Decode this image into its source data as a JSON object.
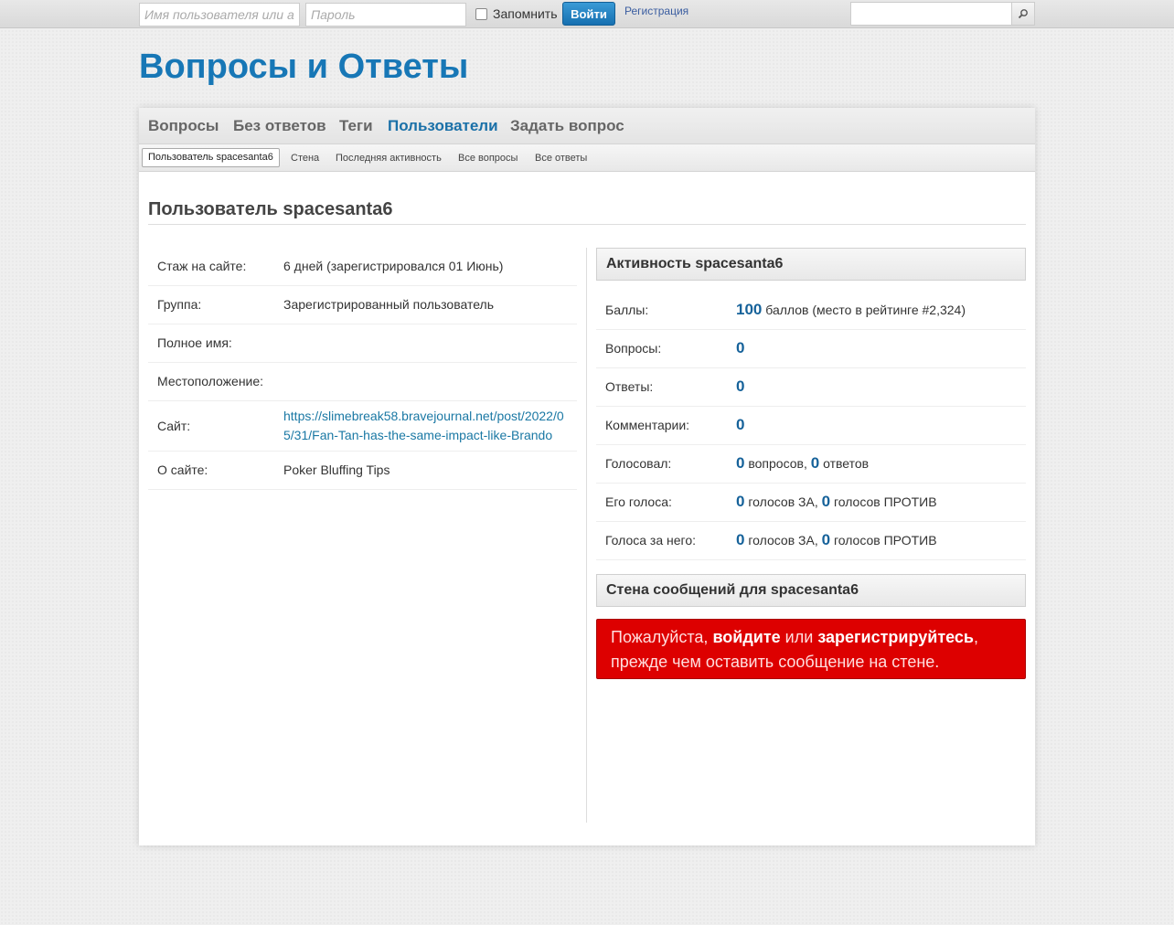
{
  "topbar": {
    "login_placeholder": "Имя пользователя или адрес",
    "password_placeholder": "Пароль",
    "remember_label": "Запомнить",
    "login_button": "Войти",
    "register_link": "Регистрация",
    "search_placeholder": ""
  },
  "site_title": "Вопросы и Ответы",
  "nav": {
    "items": [
      "Вопросы",
      "Без ответов",
      "Теги",
      "Пользователи",
      "Задать вопрос"
    ],
    "active": "Пользователи"
  },
  "subnav": {
    "items": [
      "Пользователь spacesanta6",
      "Стена",
      "Последняя активность",
      "Все вопросы",
      "Все ответы"
    ],
    "selected": "Пользователь spacesanta6"
  },
  "page_title": "Пользователь spacesanta6",
  "profile": {
    "rows": [
      {
        "label": "Стаж на сайте:",
        "value": "6 дней (зарегистрировался 01 Июнь)"
      },
      {
        "label": "Группа:",
        "value": "Зарегистрированный пользователь"
      },
      {
        "label": "Полное имя:",
        "value": ""
      },
      {
        "label": "Местоположение:",
        "value": ""
      },
      {
        "label": "Сайт:",
        "value": "https://slimebreak58.bravejournal.net/post/2022/05/31/Fan-Tan-has-the-same-impact-like-Brando"
      },
      {
        "label": "О сайте:",
        "value": "Poker Bluffing Tips"
      }
    ]
  },
  "activity": {
    "heading": "Активность spacesanta6",
    "points_label": "Баллы:",
    "points": "100",
    "points_text": "баллов (место в рейтинге #2,324)",
    "questions_label": "Вопросы:",
    "questions": "0",
    "answers_label": "Ответы:",
    "answers": "0",
    "comments_label": "Комментарии:",
    "comments": "0",
    "voted_label": "Голосовал:",
    "voted_questions": "0",
    "voted_questions_text": "вопросов,",
    "voted_answers": "0",
    "voted_answers_text": "ответов",
    "his_votes_label": "Его голоса:",
    "his_up": "0",
    "his_up_text": "голосов ЗА,",
    "his_down": "0",
    "his_down_text": "голосов ПРОТИВ",
    "votes_for_label": "Голоса за него:",
    "for_up": "0",
    "for_up_text": "голосов ЗА,",
    "for_down": "0",
    "for_down_text": "голосов ПРОТИВ"
  },
  "wall": {
    "heading": "Стена сообщений для spacesanta6",
    "msg_pre": "Пожалуйста,",
    "login_link": "войдите",
    "msg_mid": "или",
    "register_link": "зарегистрируйтесь",
    "msg_post": ", прежде чем оставить сообщение на стене."
  },
  "colors": {
    "accent": "#1777b6",
    "number": "#16629a",
    "alert_bg": "#dd0000"
  }
}
